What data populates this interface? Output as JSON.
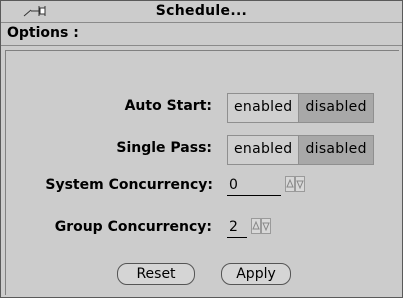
{
  "window": {
    "title": "Schedule..."
  },
  "section": {
    "label": "Options :"
  },
  "options": {
    "auto_start": {
      "label": "Auto Start:",
      "enabled": "enabled",
      "disabled": "disabled",
      "selected": "disabled"
    },
    "single_pass": {
      "label": "Single Pass:",
      "enabled": "enabled",
      "disabled": "disabled",
      "selected": "disabled"
    },
    "system_concurrency": {
      "label": "System Concurrency:",
      "value": "0"
    },
    "group_concurrency": {
      "label": "Group Concurrency:",
      "value": "2"
    }
  },
  "buttons": {
    "reset": "Reset",
    "apply": "Apply"
  },
  "icons": {
    "pin": "pushpin-icon",
    "spin_up": "up-arrow-icon",
    "spin_down": "down-arrow-icon"
  }
}
